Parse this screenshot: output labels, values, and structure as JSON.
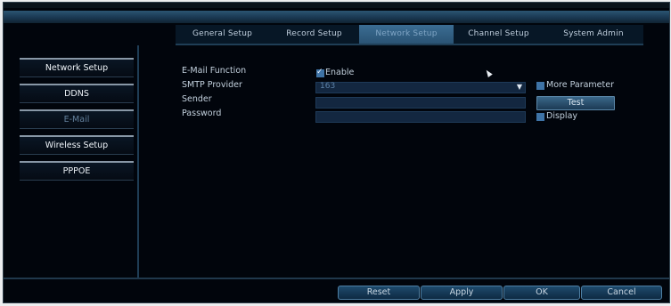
{
  "tabs": [
    {
      "label": "General Setup",
      "active": false
    },
    {
      "label": "Record Setup",
      "active": false
    },
    {
      "label": "Network Setup",
      "active": true
    },
    {
      "label": "Channel Setup",
      "active": false
    },
    {
      "label": "System Admin",
      "active": false
    }
  ],
  "sidebar": [
    {
      "label": "Network Setup",
      "active": false
    },
    {
      "label": "DDNS",
      "active": false
    },
    {
      "label": "E-Mail",
      "active": true
    },
    {
      "label": "Wireless Setup",
      "active": false
    },
    {
      "label": "PPPOE",
      "active": false
    }
  ],
  "form": {
    "email_function_label": "E-Mail Function",
    "enable_label": "Enable",
    "enable_checked": true,
    "smtp_label": "SMTP Provider",
    "smtp_value": "163",
    "more_parameter_label": "More Parameter",
    "more_parameter_checked": false,
    "sender_label": "Sender",
    "sender_value": "",
    "test_label": "Test",
    "password_label": "Password",
    "password_value": "",
    "display_label": "Display",
    "display_checked": false
  },
  "footer": {
    "reset_label": "Reset",
    "apply_label": "Apply",
    "ok_label": "OK",
    "cancel_label": "Cancel"
  },
  "icons": {
    "dropdown_arrow": "chevron-down-icon",
    "checkmark": "check-icon",
    "cursor": "mouse-pointer-icon"
  },
  "colors": {
    "background": "#01050c",
    "active_tab": "#3b6d93",
    "checkbox": "#3e73a6",
    "field": "#132740"
  }
}
